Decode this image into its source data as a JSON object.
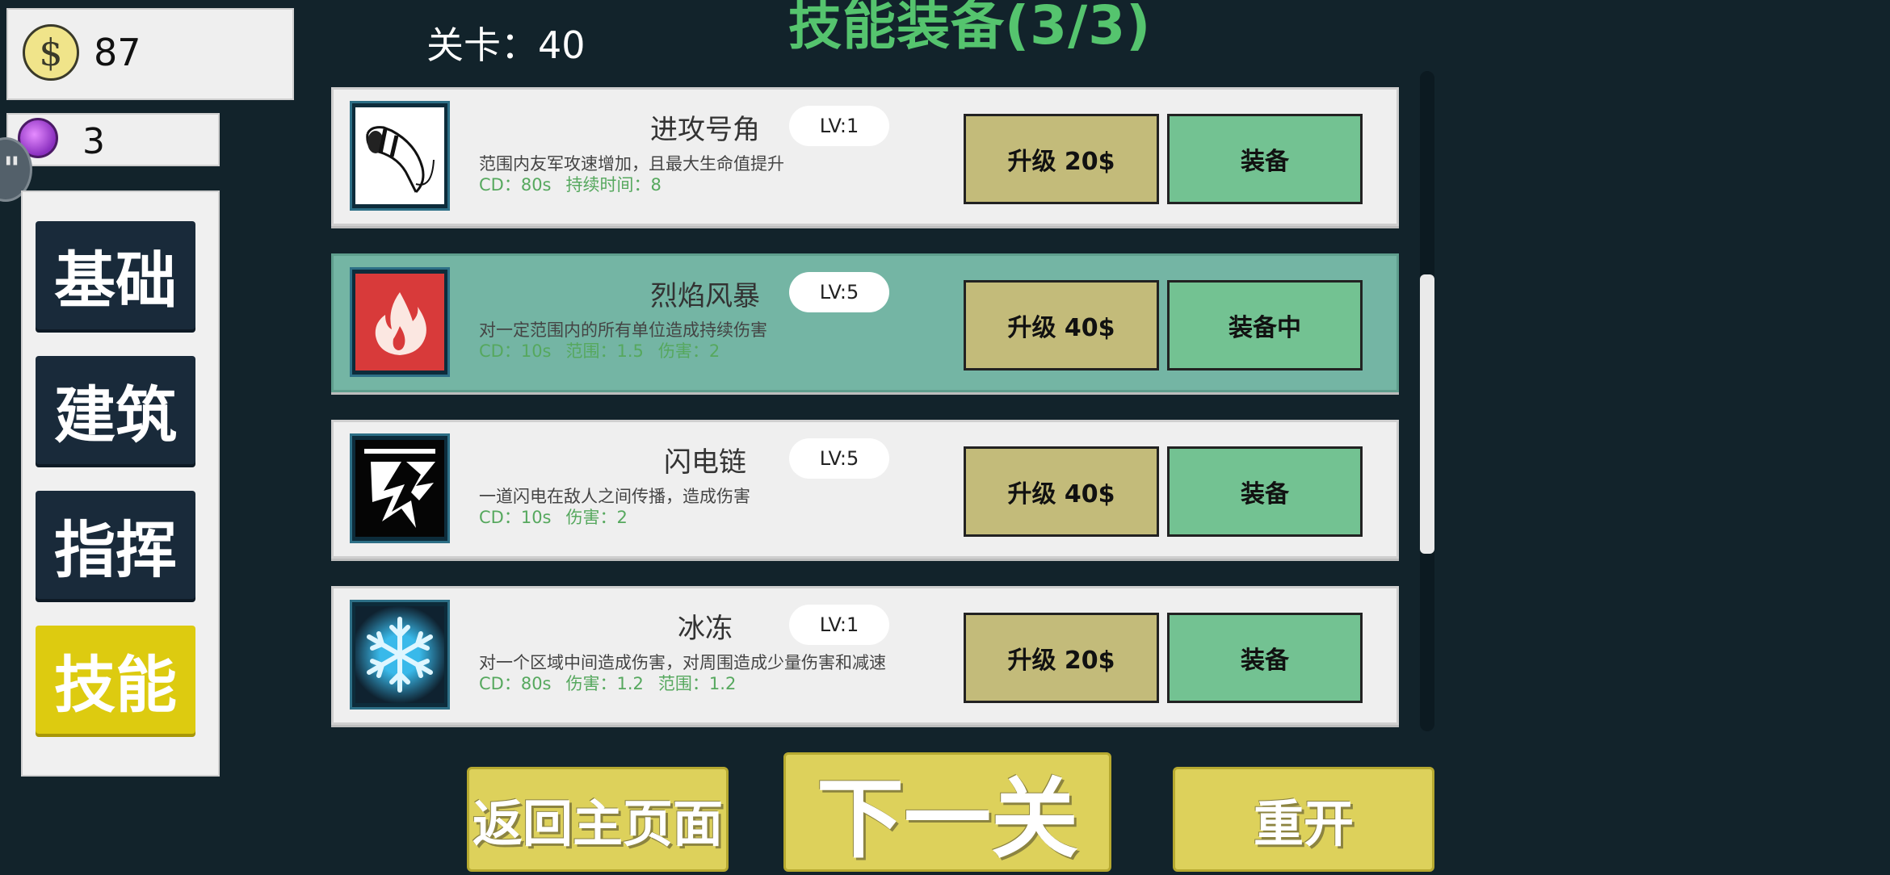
{
  "currency": {
    "coins": "87",
    "gems": "3",
    "coin_symbol": "$"
  },
  "side_tab": {
    "label": "\""
  },
  "categories": [
    {
      "label": "基础",
      "active": false
    },
    {
      "label": "建筑",
      "active": false
    },
    {
      "label": "指挥",
      "active": false
    },
    {
      "label": "技能",
      "active": true
    }
  ],
  "header": {
    "level": "关卡：40",
    "title": "技能装备(3/3)"
  },
  "skills": [
    {
      "name": "进攻号角",
      "level": "LV:1",
      "description": "范围内友军攻速增加，且最大生命值提升",
      "stats": [
        "CD：80s",
        "持续时间：8"
      ],
      "upgrade": "升级 20$",
      "equip": "装备",
      "equipped": false,
      "icon": "horn-icon"
    },
    {
      "name": "烈焰风暴",
      "level": "LV:5",
      "description": "对一定范围内的所有单位造成持续伤害",
      "stats": [
        "CD：10s",
        "范围：1.5",
        "伤害：2"
      ],
      "upgrade": "升级 40$",
      "equip": "装备中",
      "equipped": true,
      "icon": "flame-icon"
    },
    {
      "name": "闪电链",
      "level": "LV:5",
      "description": "一道闪电在敌人之间传播，造成伤害",
      "stats": [
        "CD：10s",
        "伤害：2"
      ],
      "upgrade": "升级 40$",
      "equip": "装备",
      "equipped": false,
      "icon": "lightning-icon"
    },
    {
      "name": "冰冻",
      "level": "LV:1",
      "description": "对一个区域中间造成伤害，对周围造成少量伤害和减速",
      "stats": [
        "CD：80s",
        "伤害：1.2",
        "范围：1.2"
      ],
      "upgrade": "升级 20$",
      "equip": "装备",
      "equipped": false,
      "icon": "snowflake-icon"
    }
  ],
  "footer": {
    "home": "返回主页面",
    "next": "下一关",
    "restart": "重开"
  },
  "colors": {
    "background": "#12232b",
    "title_green": "#55c46e",
    "equipped_row": "#74b5a4",
    "upgrade_button": "#c3bb7a",
    "equip_button": "#73c292",
    "active_category": "#ddcb10",
    "footer_button": "#ddd15b"
  }
}
